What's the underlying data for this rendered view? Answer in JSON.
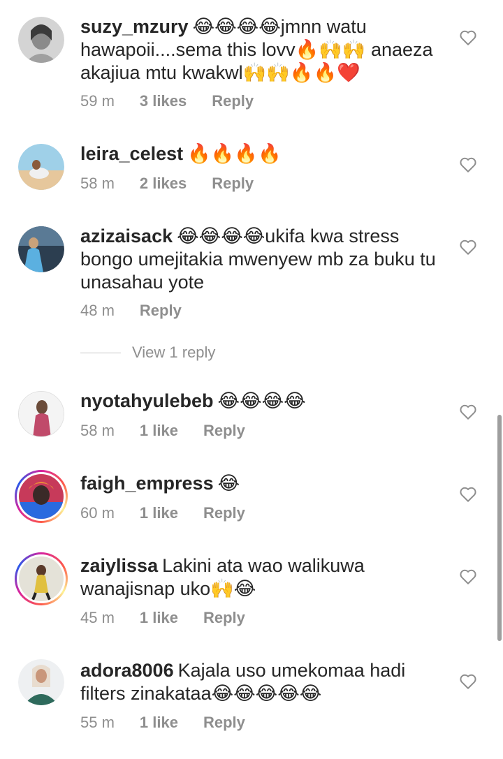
{
  "comments": [
    {
      "username": "suzy_mzury",
      "text": "😂😂😂😂jmnn watu hawapoii....sema this lovv🔥🙌🙌 anaeza akajiua mtu kwakwl🙌🙌🔥🔥❤️",
      "time": "59 m",
      "likes": "3 likes",
      "reply": "Reply",
      "avatar_color": "#c8c8c8"
    },
    {
      "username": "leira_celest",
      "text": "🔥🔥🔥🔥",
      "time": "58 m",
      "likes": "2 likes",
      "reply": "Reply",
      "avatar_color": "#e9c49a"
    },
    {
      "username": "azizaisack",
      "text": "😂😂😂😂ukifa kwa stress bongo umejitakia mwenyew mb za buku tu unasahau yote",
      "time": "48 m",
      "reply": "Reply",
      "avatar_color": "#4a7aa8"
    },
    {
      "username": "nyotahyulebeb",
      "text": "😂😂😂😂",
      "time": "58 m",
      "likes": "1 like",
      "reply": "Reply",
      "avatar_color": "#6b4c3a"
    },
    {
      "username": "faigh_empress",
      "text": "😂",
      "time": "60 m",
      "likes": "1 like",
      "reply": "Reply",
      "avatar_color": "#3a2a28"
    },
    {
      "username": "zaiylissa",
      "text": "Lakini ata wao walikuwa wanajisnap uko🙌😂",
      "time": "45 m",
      "likes": "1 like",
      "reply": "Reply",
      "avatar_color": "#d9d5c8"
    },
    {
      "username": "adora8006",
      "text": "Kajala uso umekomaa hadi filters zinakataa😂😂😂😂😂",
      "time": "55 m",
      "likes": "1 like",
      "reply": "Reply",
      "avatar_color": "#4a6d5c"
    }
  ],
  "view_replies": "View 1 reply",
  "colors": {
    "text": "#262626",
    "muted": "#8e8e8e"
  }
}
